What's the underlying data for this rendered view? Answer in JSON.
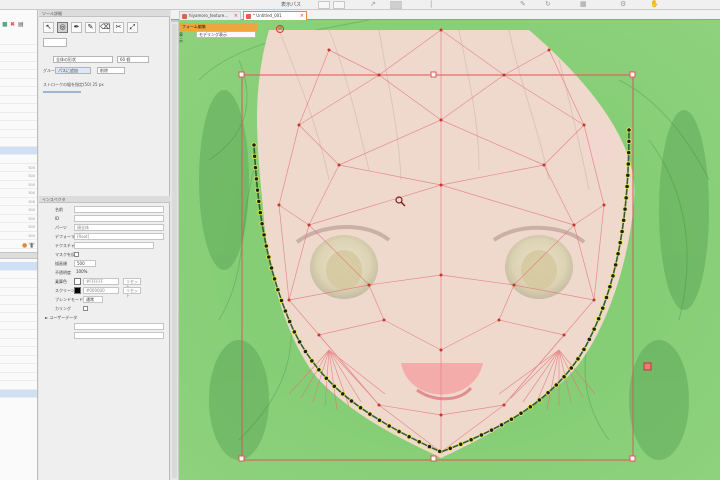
{
  "topbar": {
    "label": "表示パス"
  },
  "left_panel": {
    "rows": [
      "",
      "",
      "",
      "",
      "",
      "",
      "",
      "",
      "",
      "",
      "",
      "",
      "",
      "",
      "",
      "",
      "",
      "",
      "",
      "",
      "",
      "",
      "",
      "",
      "",
      "",
      ""
    ],
    "row_values": [
      "",
      "",
      "",
      "",
      "",
      "",
      "",
      "",
      "",
      "",
      "",
      "",
      "",
      "",
      "",
      "500",
      "500",
      "500",
      "500",
      "500",
      "500",
      "500",
      "500",
      "500",
      "500",
      "",
      ""
    ]
  },
  "tool_panel": {
    "title": "ツール詳細",
    "mode_select": "全体の形状",
    "count_value": "60 個",
    "group_label": "グループ",
    "btn_a": "パスに追加",
    "btn_b": "削除",
    "slider_label": "ストロークの幅を指定(50) 25 px",
    "inspector_title": "インスペクタ",
    "rows": [
      {
        "k": "名前",
        "v": ""
      },
      {
        "k": "ID",
        "v": ""
      },
      {
        "k": "パーツ",
        "v": "顔全体"
      },
      {
        "k": "デフォーマ",
        "v": "[Root]"
      },
      {
        "k": "テクスチャ",
        "v": ""
      },
      {
        "k": "マスクを反転",
        "v": ""
      },
      {
        "k": "描画順",
        "v": "500"
      },
      {
        "k": "不透明度",
        "v": "100%"
      },
      {
        "k": "乗算色",
        "v": "#FFFFFF"
      },
      {
        "k": "スクリーン色",
        "v": "#000000"
      },
      {
        "k": "ブレンドモード",
        "v": "通常"
      },
      {
        "k": "カリング",
        "v": ""
      },
      {
        "k": "► ユーザーデータ",
        "v": ""
      },
      {
        "k": "",
        "v": ""
      },
      {
        "k": "",
        "v": ""
      }
    ],
    "reset_label": "リセット"
  },
  "tabs": [
    {
      "label": "hiyamoro_texture..."
    },
    {
      "label": "* Untitled_001"
    }
  ],
  "subbar": {
    "mode": "フォーム編集",
    "display_label": "表示",
    "select_value": "モデリング表示"
  }
}
